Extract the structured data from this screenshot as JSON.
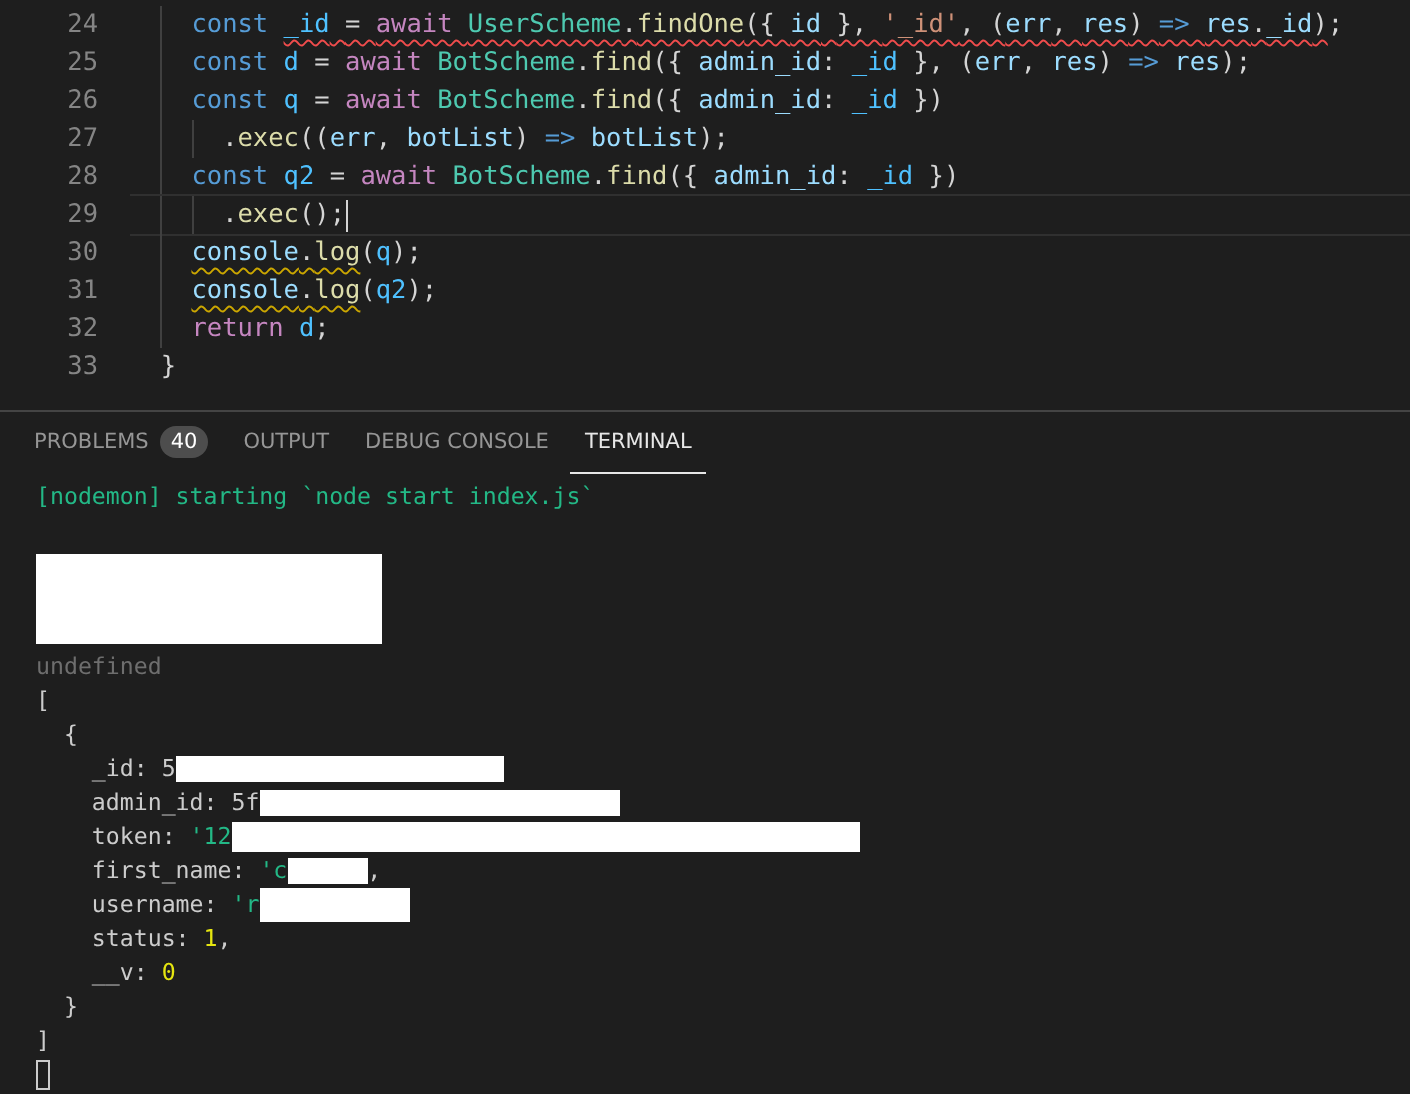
{
  "editor": {
    "lines": [
      {
        "number": "24",
        "current": false,
        "kind": "error",
        "tokens": [
          {
            "text": "    const ",
            "kind": "storage",
            "underlined": false
          },
          {
            "text": "_id",
            "kind": "constant",
            "underlined": true
          },
          {
            "text": " = ",
            "underlined": true
          },
          {
            "text": "await ",
            "kind": "control",
            "underlined": true
          },
          {
            "text": "UserScheme",
            "kind": "class",
            "underlined": true
          },
          {
            "text": ".",
            "underlined": true
          },
          {
            "text": "findOne",
            "kind": "function",
            "underlined": true
          },
          {
            "text": "({ ",
            "underlined": true
          },
          {
            "text": "id",
            "kind": "variable",
            "underlined": true
          },
          {
            "text": " }, ",
            "underlined": true
          },
          {
            "text": "'_id'",
            "kind": "string",
            "underlined": true
          },
          {
            "text": ", (",
            "underlined": true
          },
          {
            "text": "err",
            "kind": "variable",
            "underlined": true
          },
          {
            "text": ", ",
            "underlined": true
          },
          {
            "text": "res",
            "kind": "variable",
            "underlined": true
          },
          {
            "text": ") ",
            "underlined": true
          },
          {
            "text": "=> ",
            "kind": "storage",
            "underlined": true
          },
          {
            "text": "res",
            "kind": "variable",
            "underlined": true
          },
          {
            "text": ".",
            "underlined": true
          },
          {
            "text": "_id",
            "kind": "variable",
            "underlined": true
          },
          {
            "text": ")",
            "underlined": true
          },
          {
            "text": ";",
            "underlined": false
          }
        ]
      },
      {
        "number": "25",
        "current": false,
        "kind": "plain",
        "tokens": [
          {
            "text": "    const ",
            "kind": "storage",
            "underlined": false
          },
          {
            "text": "d",
            "kind": "constant",
            "underlined": false
          },
          {
            "text": " = ",
            "underlined": false
          },
          {
            "text": "await ",
            "kind": "control",
            "underlined": false
          },
          {
            "text": "BotScheme",
            "kind": "class",
            "underlined": false
          },
          {
            "text": ".",
            "underlined": false
          },
          {
            "text": "find",
            "kind": "function",
            "underlined": false
          },
          {
            "text": "({ ",
            "underlined": false
          },
          {
            "text": "admin_id",
            "kind": "variable",
            "underlined": false
          },
          {
            "text": ": ",
            "underlined": false
          },
          {
            "text": "_id",
            "kind": "constant",
            "underlined": false
          },
          {
            "text": " }, (",
            "underlined": false
          },
          {
            "text": "err",
            "kind": "variable",
            "underlined": false
          },
          {
            "text": ", ",
            "underlined": false
          },
          {
            "text": "res",
            "kind": "variable",
            "underlined": false
          },
          {
            "text": ") ",
            "underlined": false
          },
          {
            "text": "=> ",
            "kind": "storage",
            "underlined": false
          },
          {
            "text": "res",
            "kind": "variable",
            "underlined": false
          },
          {
            "text": ");",
            "underlined": false
          }
        ]
      },
      {
        "number": "26",
        "current": false,
        "kind": "plain",
        "tokens": [
          {
            "text": "    const ",
            "kind": "storage",
            "underlined": false
          },
          {
            "text": "q",
            "kind": "constant",
            "underlined": false
          },
          {
            "text": " = ",
            "underlined": false
          },
          {
            "text": "await ",
            "kind": "control",
            "underlined": false
          },
          {
            "text": "BotScheme",
            "kind": "class",
            "underlined": false
          },
          {
            "text": ".",
            "underlined": false
          },
          {
            "text": "find",
            "kind": "function",
            "underlined": false
          },
          {
            "text": "({ ",
            "underlined": false
          },
          {
            "text": "admin_id",
            "kind": "variable",
            "underlined": false
          },
          {
            "text": ": ",
            "underlined": false
          },
          {
            "text": "_id",
            "kind": "constant",
            "underlined": false
          },
          {
            "text": " })",
            "underlined": false
          }
        ]
      },
      {
        "number": "27",
        "current": false,
        "kind": "plain",
        "tokens": [
          {
            "text": "      .",
            "underlined": false
          },
          {
            "text": "exec",
            "kind": "function",
            "underlined": false
          },
          {
            "text": "((",
            "underlined": false
          },
          {
            "text": "err",
            "kind": "variable",
            "underlined": false
          },
          {
            "text": ", ",
            "underlined": false
          },
          {
            "text": "botList",
            "kind": "variable",
            "underlined": false
          },
          {
            "text": ") ",
            "underlined": false
          },
          {
            "text": "=> ",
            "kind": "storage",
            "underlined": false
          },
          {
            "text": "botList",
            "kind": "variable",
            "underlined": false
          },
          {
            "text": ");",
            "underlined": false
          }
        ]
      },
      {
        "number": "28",
        "current": false,
        "kind": "plain",
        "tokens": [
          {
            "text": "    const ",
            "kind": "storage",
            "underlined": false
          },
          {
            "text": "q2",
            "kind": "constant",
            "underlined": false
          },
          {
            "text": " = ",
            "underlined": false
          },
          {
            "text": "await ",
            "kind": "control",
            "underlined": false
          },
          {
            "text": "BotScheme",
            "kind": "class",
            "underlined": false
          },
          {
            "text": ".",
            "underlined": false
          },
          {
            "text": "find",
            "kind": "function",
            "underlined": false
          },
          {
            "text": "({ ",
            "underlined": false
          },
          {
            "text": "admin_id",
            "kind": "variable",
            "underlined": false
          },
          {
            "text": ": ",
            "underlined": false
          },
          {
            "text": "_id",
            "kind": "constant",
            "underlined": false
          },
          {
            "text": " })",
            "underlined": false
          }
        ]
      },
      {
        "number": "29",
        "current": true,
        "kind": "plain",
        "tokens": [
          {
            "text": "      .",
            "underlined": false
          },
          {
            "text": "exec",
            "kind": "function",
            "underlined": false
          },
          {
            "text": "();",
            "underlined": false
          }
        ]
      },
      {
        "number": "30",
        "current": false,
        "kind": "warning",
        "tokens": [
          {
            "text": "    console",
            "kind": "variable",
            "underlined": true
          },
          {
            "text": ".",
            "underlined": true
          },
          {
            "text": "log",
            "kind": "function",
            "underlined": true
          },
          {
            "text": "(",
            "underlined": false
          },
          {
            "text": "q",
            "kind": "constant",
            "underlined": false
          },
          {
            "text": ");",
            "underlined": false
          }
        ]
      },
      {
        "number": "31",
        "current": false,
        "kind": "warning",
        "tokens": [
          {
            "text": "    console",
            "kind": "variable",
            "underlined": true
          },
          {
            "text": ".",
            "underlined": true
          },
          {
            "text": "log",
            "kind": "function",
            "underlined": true
          },
          {
            "text": "(",
            "underlined": false
          },
          {
            "text": "q2",
            "kind": "constant",
            "underlined": false
          },
          {
            "text": ");",
            "underlined": false
          }
        ]
      },
      {
        "number": "32",
        "current": false,
        "kind": "plain",
        "tokens": [
          {
            "text": "    return ",
            "kind": "control",
            "underlined": false
          },
          {
            "text": "d",
            "kind": "constant",
            "underlined": false
          },
          {
            "text": ";",
            "underlined": false
          }
        ]
      },
      {
        "number": "33",
        "current": false,
        "kind": "plain",
        "tokens": [
          {
            "text": "  }",
            "underlined": false
          }
        ]
      }
    ]
  },
  "panel": {
    "tabs": [
      {
        "label": "PROBLEMS",
        "badge": "40",
        "selected": false
      },
      {
        "label": "OUTPUT",
        "selected": false
      },
      {
        "label": "DEBUG CONSOLE",
        "selected": false
      },
      {
        "label": "TERMINAL",
        "selected": true
      }
    ],
    "terminal": {
      "lines": [
        {
          "parts": [
            {
              "kind": "string",
              "text": "[nodemon] starting `node start index.js`"
            }
          ]
        },
        {
          "parts": [
            {
              "kind": "panel-redaction"
            }
          ]
        },
        {
          "parts": [
            {
              "kind": "muted",
              "text": "undefined"
            }
          ]
        },
        {
          "parts": [
            {
              "kind": "plain",
              "text": "["
            }
          ]
        },
        {
          "parts": [
            {
              "kind": "plain",
              "text": "  {"
            }
          ]
        },
        {
          "parts": [
            {
              "kind": "plain",
              "text": "    _id: 5"
            },
            {
              "kind": "medium-redaction"
            }
          ]
        },
        {
          "parts": [
            {
              "kind": "plain",
              "text": "    admin_id: 5f"
            },
            {
              "kind": "wide-redaction"
            }
          ]
        },
        {
          "parts": [
            {
              "kind": "plain",
              "text": "    token: "
            },
            {
              "kind": "string",
              "text": "'12"
            },
            {
              "kind": "long-redaction"
            }
          ]
        },
        {
          "parts": [
            {
              "kind": "plain",
              "text": "    first_name: "
            },
            {
              "kind": "string",
              "text": "'c"
            },
            {
              "kind": "tiny-redaction"
            },
            {
              "kind": "plain",
              "text": ","
            }
          ]
        },
        {
          "parts": [
            {
              "kind": "plain",
              "text": "    username: "
            },
            {
              "kind": "string",
              "text": "'r"
            },
            {
              "kind": "small-redaction"
            }
          ]
        },
        {
          "parts": [
            {
              "kind": "plain",
              "text": "    status: "
            },
            {
              "kind": "number",
              "text": "1"
            },
            {
              "kind": "plain",
              "text": ","
            }
          ]
        },
        {
          "parts": [
            {
              "kind": "plain",
              "text": "    __v: "
            },
            {
              "kind": "number",
              "text": "0"
            }
          ]
        },
        {
          "parts": [
            {
              "kind": "plain",
              "text": "  }"
            }
          ]
        },
        {
          "parts": [
            {
              "kind": "plain",
              "text": "]"
            }
          ]
        }
      ],
      "cursor": true
    }
  }
}
